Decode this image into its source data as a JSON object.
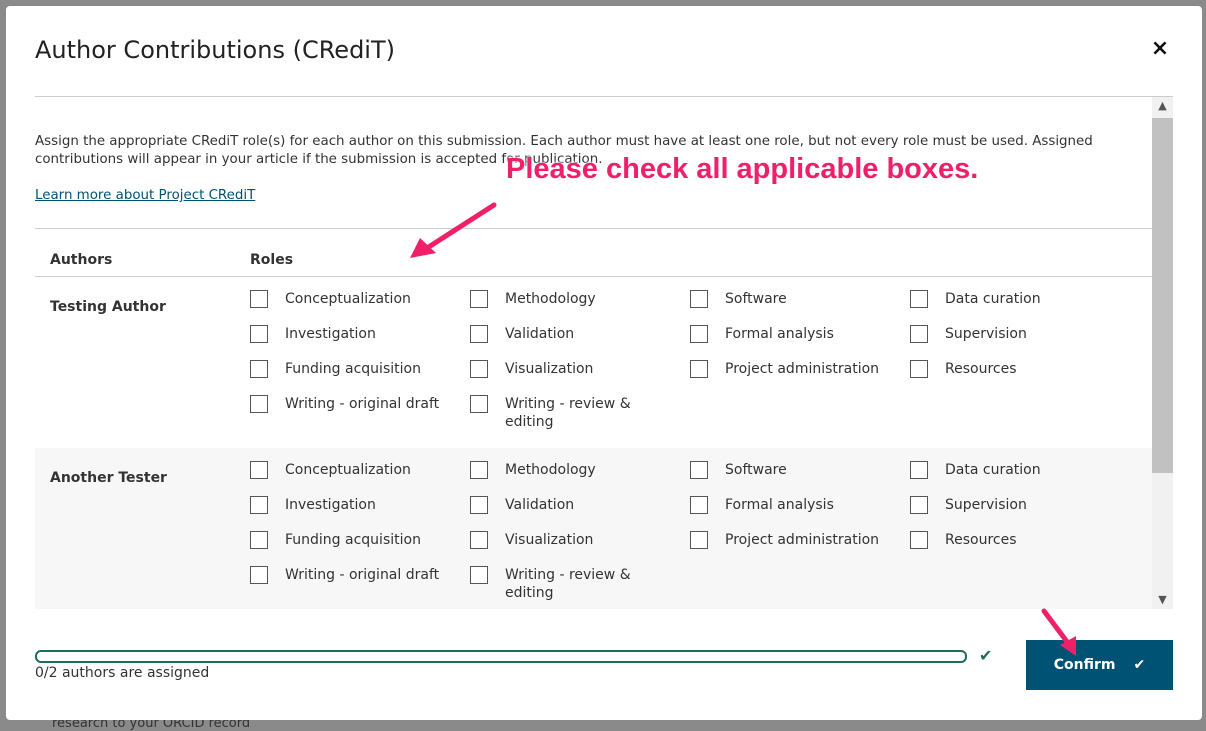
{
  "background": {
    "partial_text": "research to your ORCID record"
  },
  "modal": {
    "title": "Author Contributions (CRediT)",
    "close_icon": "×",
    "intro_text": "Assign the appropriate CRediT role(s) for each author on this submission. Each author must have at least one role, but not every role must be used. Assigned contributions will appear in your article if the submission is accepted for publication.",
    "learn_more_link": "Learn more about Project CRediT",
    "table": {
      "headers": {
        "authors": "Authors",
        "roles": "Roles"
      },
      "authors": [
        {
          "name": "Testing Author",
          "roles": [
            "Conceptualization",
            "Methodology",
            "Software",
            "Data curation",
            "Investigation",
            "Validation",
            "Formal analysis",
            "Supervision",
            "Funding acquisition",
            "Visualization",
            "Project administration",
            "Resources",
            "Writing - original draft",
            "Writing - review & editing"
          ],
          "checked": [
            false,
            false,
            false,
            false,
            false,
            false,
            false,
            false,
            false,
            false,
            false,
            false,
            false,
            false
          ]
        },
        {
          "name": "Another Tester",
          "roles": [
            "Conceptualization",
            "Methodology",
            "Software",
            "Data curation",
            "Investigation",
            "Validation",
            "Formal analysis",
            "Supervision",
            "Funding acquisition",
            "Visualization",
            "Project administration",
            "Resources",
            "Writing - original draft",
            "Writing - review & editing"
          ],
          "checked": [
            false,
            false,
            false,
            false,
            false,
            false,
            false,
            false,
            false,
            false,
            false,
            false,
            false,
            false
          ]
        }
      ]
    },
    "scrollbar": {
      "up_icon": "chevron-up-icon",
      "down_icon": "chevron-down-icon"
    },
    "footer": {
      "progress_text": "0/2 authors are assigned",
      "progress_fraction": 0,
      "confirm_label": "Confirm",
      "check_icon": "✔"
    }
  },
  "annotation": {
    "text": "Please check all applicable boxes.",
    "color": "#ef1f6a"
  },
  "colors": {
    "primary": "#005274",
    "progress": "#1f6b5c"
  }
}
